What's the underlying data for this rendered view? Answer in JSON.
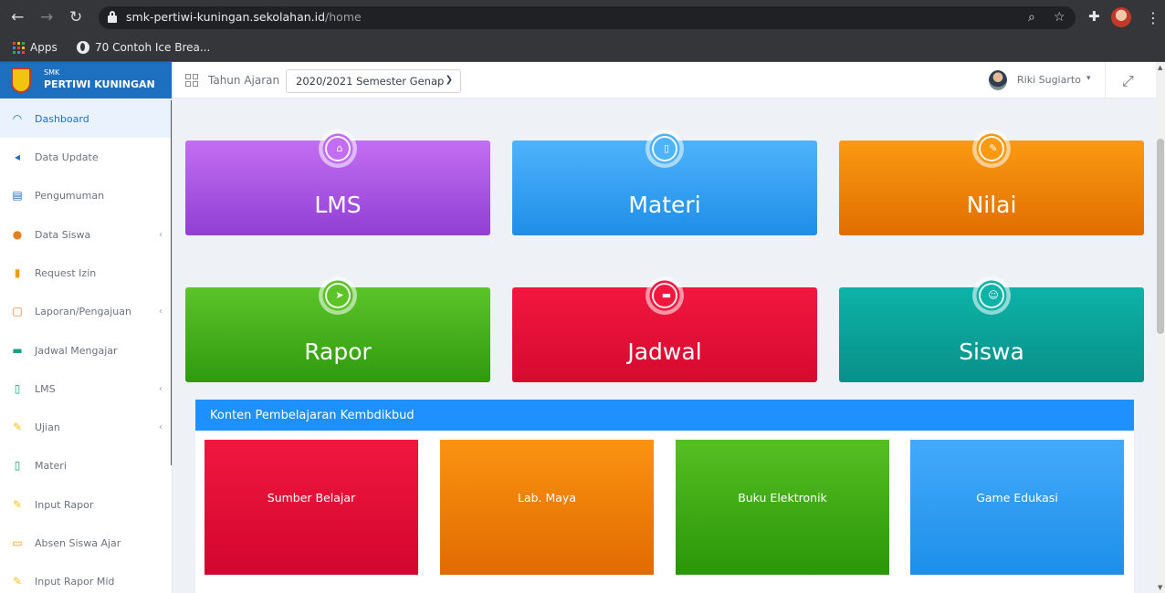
{
  "browser": {
    "url_host": "smk-pertiwi-kuningan.sekolahan.id",
    "url_path": "/home",
    "bookmarks": [
      {
        "label": "Apps",
        "icon": "apps-grid-icon"
      },
      {
        "label": "70 Contoh Ice Brea...",
        "icon": "globe-icon"
      }
    ]
  },
  "brand": {
    "small": "SMK",
    "name": "PERTIWI KUNINGAN"
  },
  "sidebar": {
    "items": [
      {
        "label": "Dashboard",
        "icon": "dashboard-icon",
        "active": true,
        "has_caret": false
      },
      {
        "label": "Data Update",
        "icon": "megaphone-icon",
        "active": false,
        "has_caret": false
      },
      {
        "label": "Pengumuman",
        "icon": "newspaper-icon",
        "active": false,
        "has_caret": false
      },
      {
        "label": "Data Siswa",
        "icon": "users-icon",
        "active": false,
        "has_caret": true
      },
      {
        "label": "Request Izin",
        "icon": "file-icon",
        "active": false,
        "has_caret": false
      },
      {
        "label": "Laporan/Pengajuan",
        "icon": "clipboard-icon",
        "active": false,
        "has_caret": true
      },
      {
        "label": "Jadwal Mengajar",
        "icon": "calendar-icon",
        "active": false,
        "has_caret": false
      },
      {
        "label": "LMS",
        "icon": "book-icon",
        "active": false,
        "has_caret": true
      },
      {
        "label": "Ujian",
        "icon": "pencil-icon",
        "active": false,
        "has_caret": true
      },
      {
        "label": "Materi",
        "icon": "book-icon",
        "active": false,
        "has_caret": false
      },
      {
        "label": "Input Rapor",
        "icon": "pencil-icon",
        "active": false,
        "has_caret": false
      },
      {
        "label": "Absen Siswa Ajar",
        "icon": "id-card-icon",
        "active": false,
        "has_caret": false
      },
      {
        "label": "Input Rapor Mid",
        "icon": "pencil-icon",
        "active": false,
        "has_caret": false
      }
    ],
    "caret": "‹"
  },
  "topbar": {
    "tahun_ajaran_label": "Tahun Ajaran",
    "tahun_ajaran_value": "2020/2021 Semester Genap",
    "user_name": "Riki Sugiarto",
    "user_caret": "▾"
  },
  "tiles": [
    {
      "label": "LMS",
      "icon": "institution-icon",
      "color_top": "#c36ef2",
      "color_bottom": "#8f3fd3"
    },
    {
      "label": "Materi",
      "icon": "book-icon",
      "color_top": "#4eb3fb",
      "color_bottom": "#1e8ee8"
    },
    {
      "label": "Nilai",
      "icon": "pencil-icon",
      "color_top": "#fb9a12",
      "color_bottom": "#e06e00"
    },
    {
      "label": "Rapor",
      "icon": "paper-plane-icon",
      "color_top": "#5cc429",
      "color_bottom": "#2f9a0e"
    },
    {
      "label": "Jadwal",
      "icon": "calendar-icon",
      "color_top": "#f2173f",
      "color_bottom": "#d50a2e"
    },
    {
      "label": "Siswa",
      "icon": "child-icon",
      "color_top": "#0db3a7",
      "color_bottom": "#08908a"
    }
  ],
  "section": {
    "title": "Konten Pembelajaran Kembdikbud",
    "cards": [
      {
        "label": "Sumber Belajar",
        "color_top": "#f1173e",
        "color_bottom": "#d2062f"
      },
      {
        "label": "Lab. Maya",
        "color_top": "#fb9311",
        "color_bottom": "#e06b00"
      },
      {
        "label": "Buku Elektronik",
        "color_top": "#56bf22",
        "color_bottom": "#2a9608"
      },
      {
        "label": "Game Edukasi",
        "color_top": "#43aafb",
        "color_bottom": "#1d8fe9"
      }
    ]
  }
}
